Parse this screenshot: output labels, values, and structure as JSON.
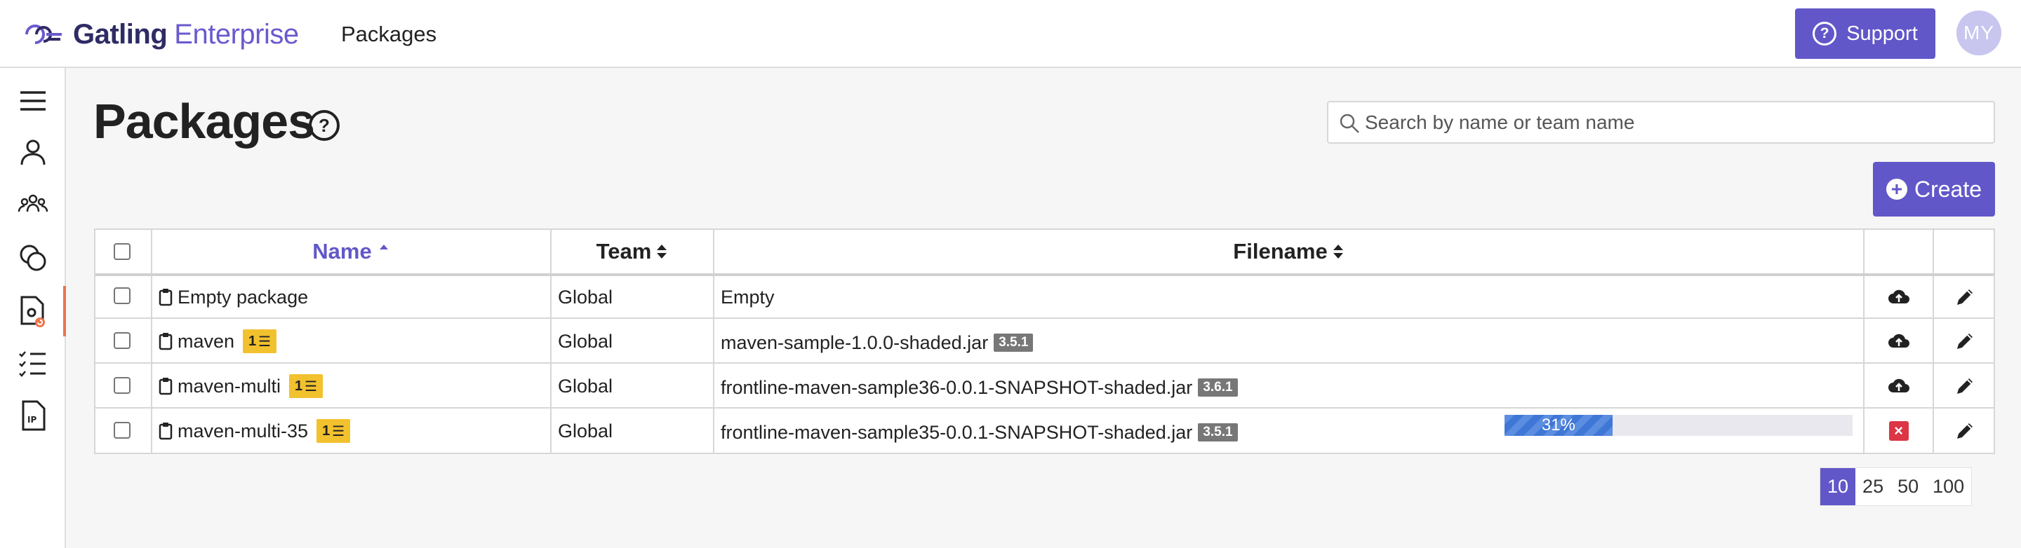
{
  "header": {
    "brand_bold": "Gatling",
    "brand_light": "Enterprise",
    "page": "Packages",
    "support_label": "Support",
    "avatar_initials": "MY",
    "accent_color": "#6257c8"
  },
  "sidebar": {
    "items": [
      {
        "icon": "menu-icon"
      },
      {
        "icon": "user-icon"
      },
      {
        "icon": "team-icon"
      },
      {
        "icon": "coins-icon"
      },
      {
        "icon": "package-settings-icon",
        "active": true
      },
      {
        "icon": "checklist-icon"
      },
      {
        "icon": "ip-document-icon"
      }
    ]
  },
  "main": {
    "title": "Packages",
    "help_icon": "question-icon",
    "search_placeholder": "Search by name or team name",
    "create_label": "Create"
  },
  "table": {
    "columns": [
      "Name",
      "Team",
      "Filename"
    ],
    "sorted_column": "Name",
    "rows": [
      {
        "name": "Empty package",
        "badge": "",
        "team": "Global",
        "filename": "Empty",
        "version": "",
        "action": "upload"
      },
      {
        "name": "maven",
        "badge": "1",
        "team": "Global",
        "filename": "maven-sample-1.0.0-shaded.jar",
        "version": "3.5.1",
        "action": "upload"
      },
      {
        "name": "maven-multi",
        "badge": "1",
        "team": "Global",
        "filename": "frontline-maven-sample36-0.0.1-SNAPSHOT-shaded.jar",
        "version": "3.6.1",
        "action": "upload"
      },
      {
        "name": "maven-multi-35",
        "badge": "1",
        "team": "Global",
        "filename": "frontline-maven-sample35-0.0.1-SNAPSHOT-shaded.jar",
        "version": "3.5.1",
        "action": "cancel",
        "progress_label": "31%",
        "progress": 0.31
      }
    ]
  },
  "pagination": {
    "sizes": [
      "10",
      "25",
      "50",
      "100"
    ],
    "active": "10"
  }
}
